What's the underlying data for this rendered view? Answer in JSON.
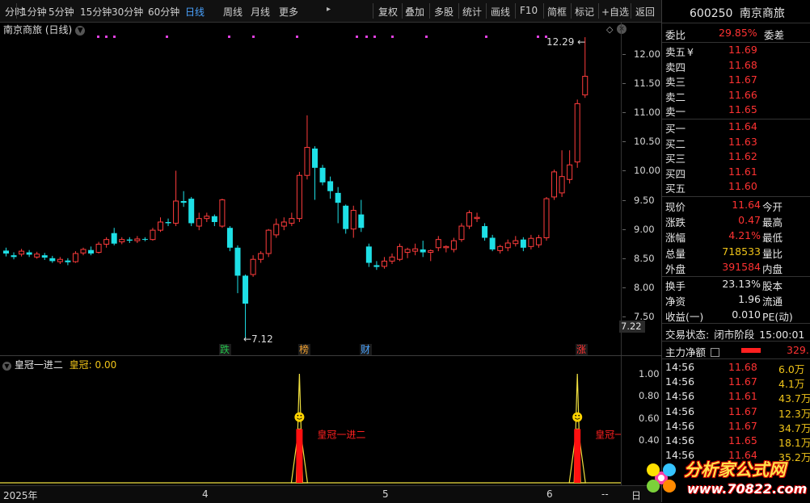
{
  "toolbar": {
    "items": [
      "分时",
      "1分钟",
      "5分钟",
      "15分钟",
      "30分钟",
      "60分钟",
      "日线",
      "周线",
      "月线",
      "更多",
      "复权",
      "叠加",
      "多股",
      "统计",
      "画线",
      "F10",
      "简框",
      "标记",
      "+自选",
      "返回"
    ],
    "active": "日线"
  },
  "chart": {
    "title": "南京商旅 (日线)",
    "high_label": "12.29",
    "low_label": "7.12",
    "price_ticks": [
      "12.00",
      "11.50",
      "11.00",
      "10.50",
      "10.00",
      "9.50",
      "9.00",
      "8.50",
      "8.00",
      "7.50"
    ],
    "current_price_tag": "7.22",
    "event_tags": [
      {
        "text": "跌",
        "color": "#22c24a"
      },
      {
        "text": "榜",
        "color": "#f0a030"
      },
      {
        "text": "财",
        "color": "#4aa3ff"
      },
      {
        "text": "涨",
        "color": "#ff3232"
      }
    ]
  },
  "chart_data": {
    "type": "candlestick",
    "candles": [
      [
        8.63,
        8.58,
        8.68,
        8.53
      ],
      [
        8.55,
        8.52,
        8.6,
        8.48
      ],
      [
        8.57,
        8.62,
        8.66,
        8.53
      ],
      [
        8.6,
        8.56,
        8.64,
        8.52
      ],
      [
        8.52,
        8.57,
        8.61,
        8.49
      ],
      [
        8.55,
        8.51,
        8.59,
        8.47
      ],
      [
        8.5,
        8.45,
        8.54,
        8.42
      ],
      [
        8.44,
        8.48,
        8.52,
        8.4
      ],
      [
        8.46,
        8.43,
        8.5,
        8.38
      ],
      [
        8.44,
        8.58,
        8.62,
        8.42
      ],
      [
        8.59,
        8.65,
        8.68,
        8.55
      ],
      [
        8.64,
        8.58,
        8.7,
        8.55
      ],
      [
        8.6,
        8.74,
        8.78,
        8.58
      ],
      [
        8.74,
        8.82,
        8.86,
        8.68
      ],
      [
        8.93,
        8.75,
        9.02,
        8.72
      ],
      [
        8.78,
        8.82,
        8.86,
        8.74
      ],
      [
        8.82,
        8.8,
        8.86,
        8.76
      ],
      [
        8.8,
        8.83,
        8.88,
        8.76
      ],
      [
        8.83,
        8.82,
        8.86,
        8.79
      ],
      [
        8.82,
        8.98,
        9.02,
        8.8
      ],
      [
        8.98,
        9.12,
        9.2,
        8.95
      ],
      [
        9.12,
        9.1,
        9.18,
        9.05
      ],
      [
        9.1,
        9.48,
        10.0,
        9.05
      ],
      [
        9.48,
        9.45,
        9.65,
        9.38
      ],
      [
        9.52,
        9.1,
        9.55,
        9.05
      ],
      [
        9.05,
        9.18,
        9.28,
        8.98
      ],
      [
        9.18,
        9.22,
        9.28,
        9.12
      ],
      [
        9.22,
        9.12,
        9.25,
        9.05
      ],
      [
        9.05,
        9.5,
        9.52,
        9.02
      ],
      [
        9.02,
        8.68,
        9.05,
        8.62
      ],
      [
        8.68,
        8.2,
        8.72,
        7.9
      ],
      [
        8.2,
        7.72,
        8.22,
        7.12
      ],
      [
        8.22,
        8.48,
        8.55,
        8.18
      ],
      [
        8.48,
        8.58,
        8.62,
        8.42
      ],
      [
        8.58,
        8.98,
        9.0,
        8.52
      ],
      [
        8.9,
        9.08,
        9.18,
        8.85
      ],
      [
        9.05,
        9.12,
        9.2,
        8.98
      ],
      [
        9.1,
        9.18,
        9.28,
        9.05
      ],
      [
        9.18,
        9.92,
        9.98,
        9.12
      ],
      [
        9.92,
        10.4,
        10.95,
        9.85
      ],
      [
        10.38,
        10.05,
        10.42,
        9.5
      ],
      [
        10.05,
        9.8,
        10.1,
        9.75
      ],
      [
        9.82,
        9.65,
        9.9,
        9.52
      ],
      [
        9.62,
        9.45,
        9.72,
        9.1
      ],
      [
        9.4,
        9.0,
        9.42,
        8.92
      ],
      [
        9.0,
        9.32,
        9.4,
        8.85
      ],
      [
        9.25,
        9.02,
        9.5,
        8.95
      ],
      [
        8.7,
        8.42,
        8.75,
        8.35
      ],
      [
        8.38,
        8.35,
        8.45,
        8.3
      ],
      [
        8.36,
        8.45,
        8.52,
        8.32
      ],
      [
        8.45,
        8.52,
        8.58,
        8.4
      ],
      [
        8.48,
        8.7,
        8.75,
        8.45
      ],
      [
        8.6,
        8.65,
        8.68,
        8.5
      ],
      [
        8.62,
        8.66,
        8.75,
        8.55
      ],
      [
        8.65,
        8.6,
        8.8,
        8.52
      ],
      [
        8.6,
        8.63,
        8.65,
        8.45
      ],
      [
        8.68,
        8.82,
        8.88,
        8.62
      ],
      [
        8.68,
        8.7,
        8.72,
        8.6
      ],
      [
        8.65,
        8.8,
        8.85,
        8.6
      ],
      [
        8.82,
        9.05,
        9.1,
        8.78
      ],
      [
        9.05,
        9.28,
        9.32,
        9.0
      ],
      [
        9.18,
        9.2,
        9.28,
        9.12
      ],
      [
        9.05,
        8.85,
        9.1,
        8.8
      ],
      [
        8.85,
        8.65,
        8.9,
        8.62
      ],
      [
        8.63,
        8.7,
        8.73,
        8.58
      ],
      [
        8.68,
        8.76,
        8.82,
        8.62
      ],
      [
        8.75,
        8.8,
        8.88,
        8.7
      ],
      [
        8.82,
        8.68,
        8.86,
        8.62
      ],
      [
        8.7,
        8.84,
        8.9,
        8.65
      ],
      [
        8.73,
        8.85,
        8.9,
        8.68
      ],
      [
        8.85,
        9.52,
        9.55,
        8.8
      ],
      [
        9.55,
        9.98,
        10.02,
        9.5
      ],
      [
        9.62,
        9.9,
        10.35,
        9.55
      ],
      [
        9.85,
        10.1,
        10.35,
        9.78
      ],
      [
        10.15,
        11.15,
        11.22,
        10.05
      ],
      [
        11.3,
        11.62,
        12.29,
        11.25
      ]
    ],
    "ylim": [
      7.0,
      12.5
    ]
  },
  "indicator": {
    "name": "皇冠一进二",
    "value_label": "皇冠:",
    "value": "0.00",
    "annotation": "皇冠一进二",
    "ticks": [
      "1.00",
      "0.80",
      "0.60",
      "0.40"
    ],
    "signals": [
      38,
      74
    ]
  },
  "xaxis": {
    "labels": [
      "2025年",
      "4",
      "5",
      "6"
    ],
    "dashes": "--",
    "day_btn": "日"
  },
  "quote": {
    "code": "600250",
    "name": "南京商旅",
    "weibi_label": "委比",
    "weibi_value": "29.85%",
    "weicha_label": "委差",
    "asks": [
      {
        "label": "卖五",
        "price": "11.69",
        "mark": "¥"
      },
      {
        "label": "卖四",
        "price": "11.68",
        "mark": ""
      },
      {
        "label": "卖三",
        "price": "11.67",
        "mark": ""
      },
      {
        "label": "卖二",
        "price": "11.66",
        "mark": ""
      },
      {
        "label": "卖一",
        "price": "11.65",
        "mark": ""
      }
    ],
    "bids": [
      {
        "label": "买一",
        "price": "11.64"
      },
      {
        "label": "买二",
        "price": "11.63"
      },
      {
        "label": "买三",
        "price": "11.62"
      },
      {
        "label": "买四",
        "price": "11.61"
      },
      {
        "label": "买五",
        "price": "11.60"
      }
    ],
    "stats": [
      {
        "l": "现价",
        "v": "11.64",
        "r": "今开",
        "vc": "red"
      },
      {
        "l": "涨跌",
        "v": "0.47",
        "r": "最高",
        "vc": "red"
      },
      {
        "l": "涨幅",
        "v": "4.21%",
        "r": "最低",
        "vc": "red"
      },
      {
        "l": "总量",
        "v": "718533",
        "r": "量比",
        "vc": "yellow"
      },
      {
        "l": "外盘",
        "v": "391584",
        "r": "内盘",
        "vc": "red"
      }
    ],
    "stats2": [
      {
        "l": "换手",
        "v": "23.13%",
        "r": "股本"
      },
      {
        "l": "净资",
        "v": "1.96",
        "r": "流通"
      },
      {
        "l": "收益(一)",
        "v": "0.010",
        "r": "PE(动)"
      }
    ],
    "status_label": "交易状态:",
    "status_value": "闭市阶段",
    "status_time": "15:00:01",
    "mainflow_label": "主力净额",
    "mainflow_value": "329.",
    "ticks": [
      {
        "t": "14:56",
        "p": "11.68",
        "v": "6.0万"
      },
      {
        "t": "14:56",
        "p": "11.67",
        "v": "4.1万"
      },
      {
        "t": "14:56",
        "p": "11.61",
        "v": "43.7万"
      },
      {
        "t": "14:56",
        "p": "11.67",
        "v": "12.3万"
      },
      {
        "t": "14:56",
        "p": "11.67",
        "v": "34.7万"
      },
      {
        "t": "14:56",
        "p": "11.65",
        "v": "18.1万"
      },
      {
        "t": "14:56",
        "p": "11.64",
        "v": "35.2万"
      }
    ]
  },
  "watermark": {
    "text": "分析家公式网",
    "url": "www.70822.com"
  }
}
